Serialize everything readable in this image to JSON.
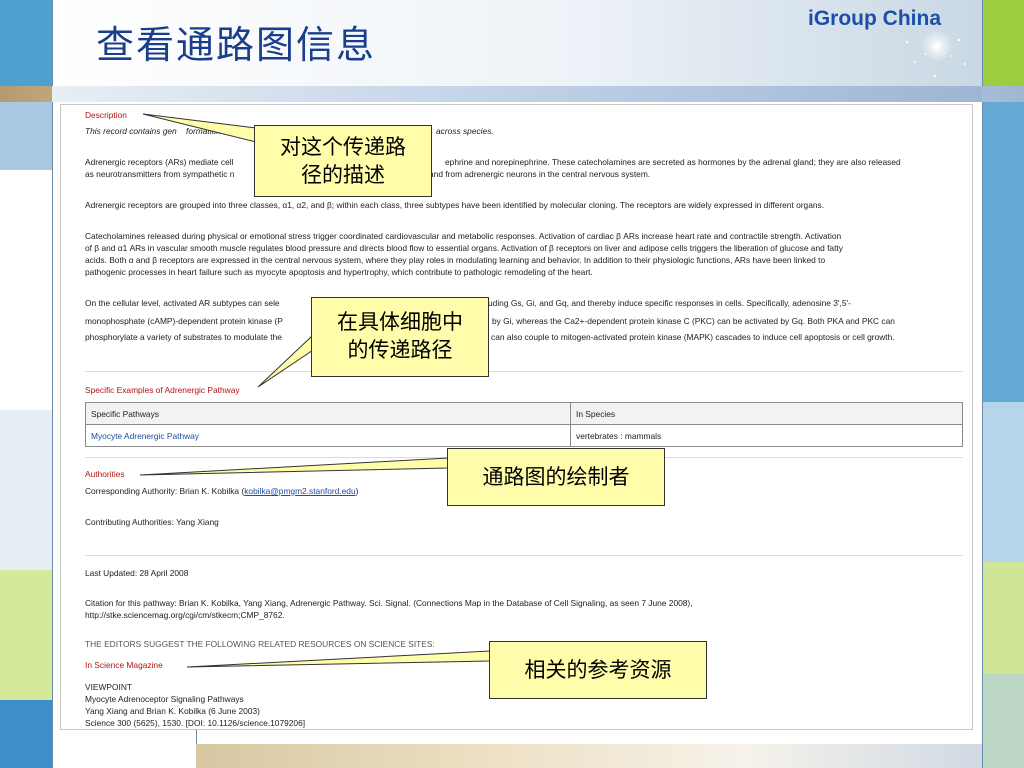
{
  "slide": {
    "title": "查看通路图信息",
    "brand": "iGroup China"
  },
  "page": {
    "description_heading": "Description",
    "para1_a": "This record contains gen",
    "para1_b": "formation",
    "para1_c": "across species.",
    "para2_line1_a": "Adrenergic receptors (ARs) mediate cell",
    "para2_line1_b": "ephrine and norepinephrine. These catecholamines are secreted as hormones by the adrenal gland; they are also released",
    "para2_line2_a": "as neurotransmitters from sympathetic n",
    "para2_line2_b": "and from adrenergic neurons in the central nervous system.",
    "para3": "Adrenergic receptors are grouped into three classes, α1, α2, and β; within each class, three subtypes have been identified by molecular cloning. The receptors are widely expressed in different organs.",
    "para4_line1": "Catecholamines released during physical or emotional stress trigger coordinated cardiovascular and metabolic responses. Activation of cardiac β ARs increase heart rate and contractile strength. Activation",
    "para4_line2": "of β and α1 ARs in vascular smooth muscle regulates blood pressure and directs blood flow to essential organs. Activation of β receptors on liver and adipose cells triggers the liberation of glucose and fatty",
    "para4_line3": "acids. Both α and β receptors are expressed in the central nervous system, where they play roles in modulating learning and behavior. In addition to their physiologic functions, ARs have been linked to",
    "para4_line4": "pathogenic processes in heart failure such as myocyte apoptosis and hypertrophy, which contribute to pathologic remodeling of the heart.",
    "para5_line1_a": "On the cellular level, activated AR subtypes can sele",
    "para5_line1_b": "uding Gs, Gi, and Gq, and thereby induce specific responses in cells. Specifically, adenosine 3',5'-",
    "para5_line2_a": "monophosphate (cAMP)-dependent protein kinase (P",
    "para5_line2_b": "by Gi, whereas the Ca2+-dependent protein kinase C (PKC) can be activated by Gq. Both PKA and PKC can",
    "para5_line3_a": "phosphorylate a variety of substrates to modulate the",
    "para5_line3_b": "can also couple to mitogen-activated protein kinase (MAPK) cascades to induce cell apoptosis or cell growth.",
    "examples_heading": "Specific Examples of Adrenergic Pathway",
    "table": {
      "headers": [
        "Specific Pathways",
        "In Species"
      ],
      "row": [
        "Myocyte Adrenergic Pathway",
        "vertebrates : mammals"
      ]
    },
    "authorities_heading": "Authorities",
    "corresponding_prefix": "Corresponding Authority: Brian K. Kobilka (",
    "corresponding_email": "kobilka@pmgm2.stanford.edu",
    "corresponding_suffix": ")",
    "contributing": "Contributing Authorities: Yang Xiang",
    "last_updated": "Last Updated: 28 April 2008",
    "citation_line1": "Citation for this pathway: Brian K. Kobilka, Yang Xiang, Adrenergic Pathway. Sci. Signal. (Connections Map in the Database of Cell Signaling, as seen 7 June 2008),",
    "citation_line2": "http://stke.sciencemag.org/cgi/cm/stkecm;CMP_8762.",
    "editors_suggest": "THE EDITORS SUGGEST THE FOLLOWING RELATED RESOURCES ON SCIENCE SITES:",
    "in_science_heading": "In Science Magazine",
    "viewpoint": "VIEWPOINT",
    "resource_title": "Myocyte Adrenoceptor Signaling Pathways",
    "resource_authors": "Yang Xiang and Brian K. Kobilka (6 June 2003)",
    "resource_ref": "Science 300 (5625), 1530. [DOI: 10.1126/science.1079206]"
  },
  "callouts": {
    "description": "对这个传递路径的描述",
    "description_l1": "对这个传递路",
    "description_l2": "径的描述",
    "cell": "在具体细胞中的传递路径",
    "cell_l1": "在具体细胞中",
    "cell_l2": "的传递路径",
    "authors": "通路图的绘制者",
    "resources": "相关的参考资源"
  },
  "colors": {
    "title": "#1a3d8c",
    "brand": "#1d4ea8",
    "heading_red": "#b31313",
    "callout_fill": "#fffcaa"
  }
}
